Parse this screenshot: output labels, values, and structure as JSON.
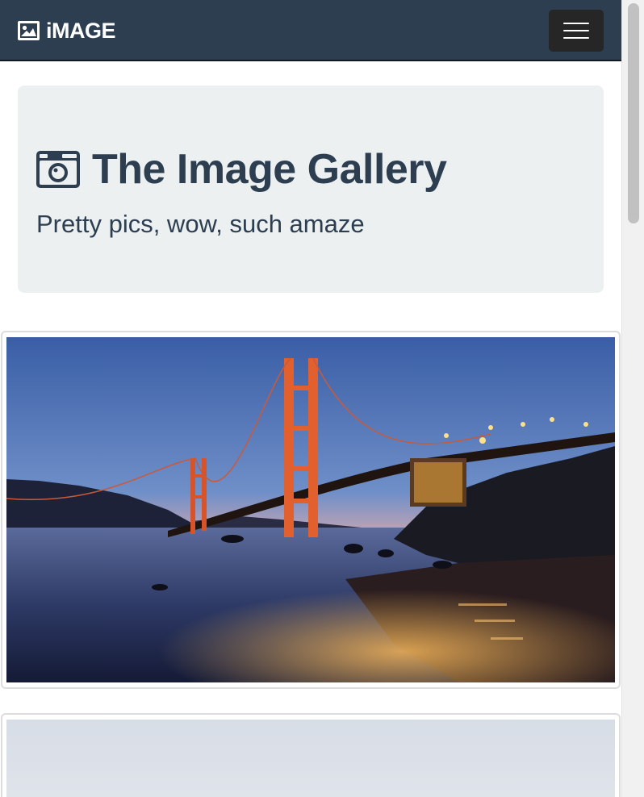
{
  "navbar": {
    "brand_label": "iMAGE",
    "brand_icon": "image-icon",
    "menu_icon": "hamburger-menu-icon",
    "background_color": "#2c3e50"
  },
  "jumbotron": {
    "title": "The Image Gallery",
    "title_icon": "camera-icon",
    "subtitle": "Pretty pics, wow, such amaze",
    "background_color": "#ecf0f1",
    "text_color": "#2c3e50"
  },
  "gallery": {
    "items": [
      {
        "image": "golden-gate-bridge-at-dusk-photo"
      },
      {
        "image": "pale-misty-sky-photo"
      }
    ]
  }
}
